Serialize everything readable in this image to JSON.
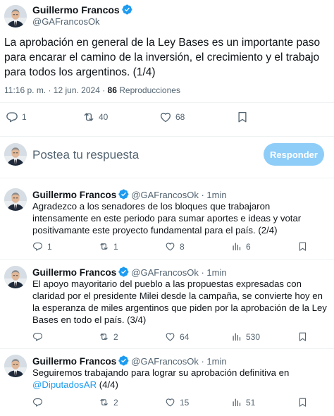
{
  "main_tweet": {
    "author_name": "Guillermo Francos",
    "author_handle": "@GAFrancosOk",
    "text": "La aprobación en general de la Ley Bases es un importante paso para encarar el camino de la inversión, el crecimiento y el trabajo para todos los argentinos. (1/4)",
    "time": "11:16 p. m. · 12 jun. 2024 · ",
    "views_count": "86",
    "views_label": " Reproducciones",
    "replies": "1",
    "retweets": "40",
    "likes": "68"
  },
  "reply_box": {
    "placeholder": "Postea tu respuesta",
    "button_label": "Responder"
  },
  "replies": [
    {
      "author_name": "Guillermo Francos",
      "author_handle": "@GAFrancosOk · 1min",
      "text": "Agradezco a los senadores de los bloques que trabajaron intensamente en este periodo para sumar aportes e ideas y  votar positivamante este proyecto fundamental para el país. (2/4)",
      "replies": "1",
      "retweets": "1",
      "likes": "8",
      "views": "6"
    },
    {
      "author_name": "Guillermo Francos",
      "author_handle": "@GAFrancosOk · 1min",
      "text": "El apoyo mayoritario del pueblo a las propuestas expresadas con claridad por el presidente Milei desde la campaña, se convierte hoy en la esperanza de miles argentinos que piden por la aprobación de la Ley Bases en todo el país. (3/4)",
      "replies": "",
      "retweets": "2",
      "likes": "64",
      "views": "530"
    },
    {
      "author_name": "Guillermo Francos",
      "author_handle": "@GAFrancosOk · 1min",
      "text": "Seguiremos trabajando para lograr su aprobación definitiva en ",
      "mention": "@DiputadosAR",
      "text_end": " (4/4)",
      "replies": "",
      "retweets": "2",
      "likes": "15",
      "views": "51"
    }
  ],
  "colors": {
    "text": "#0f1419",
    "secondary": "#536471",
    "accent": "#1d9bf0",
    "button_disabled": "#8ecdf8",
    "verified": "#1d9bf0"
  },
  "icons": [
    "verified-badge-icon",
    "reply-icon",
    "retweet-icon",
    "like-icon",
    "bookmark-icon",
    "views-icon"
  ]
}
